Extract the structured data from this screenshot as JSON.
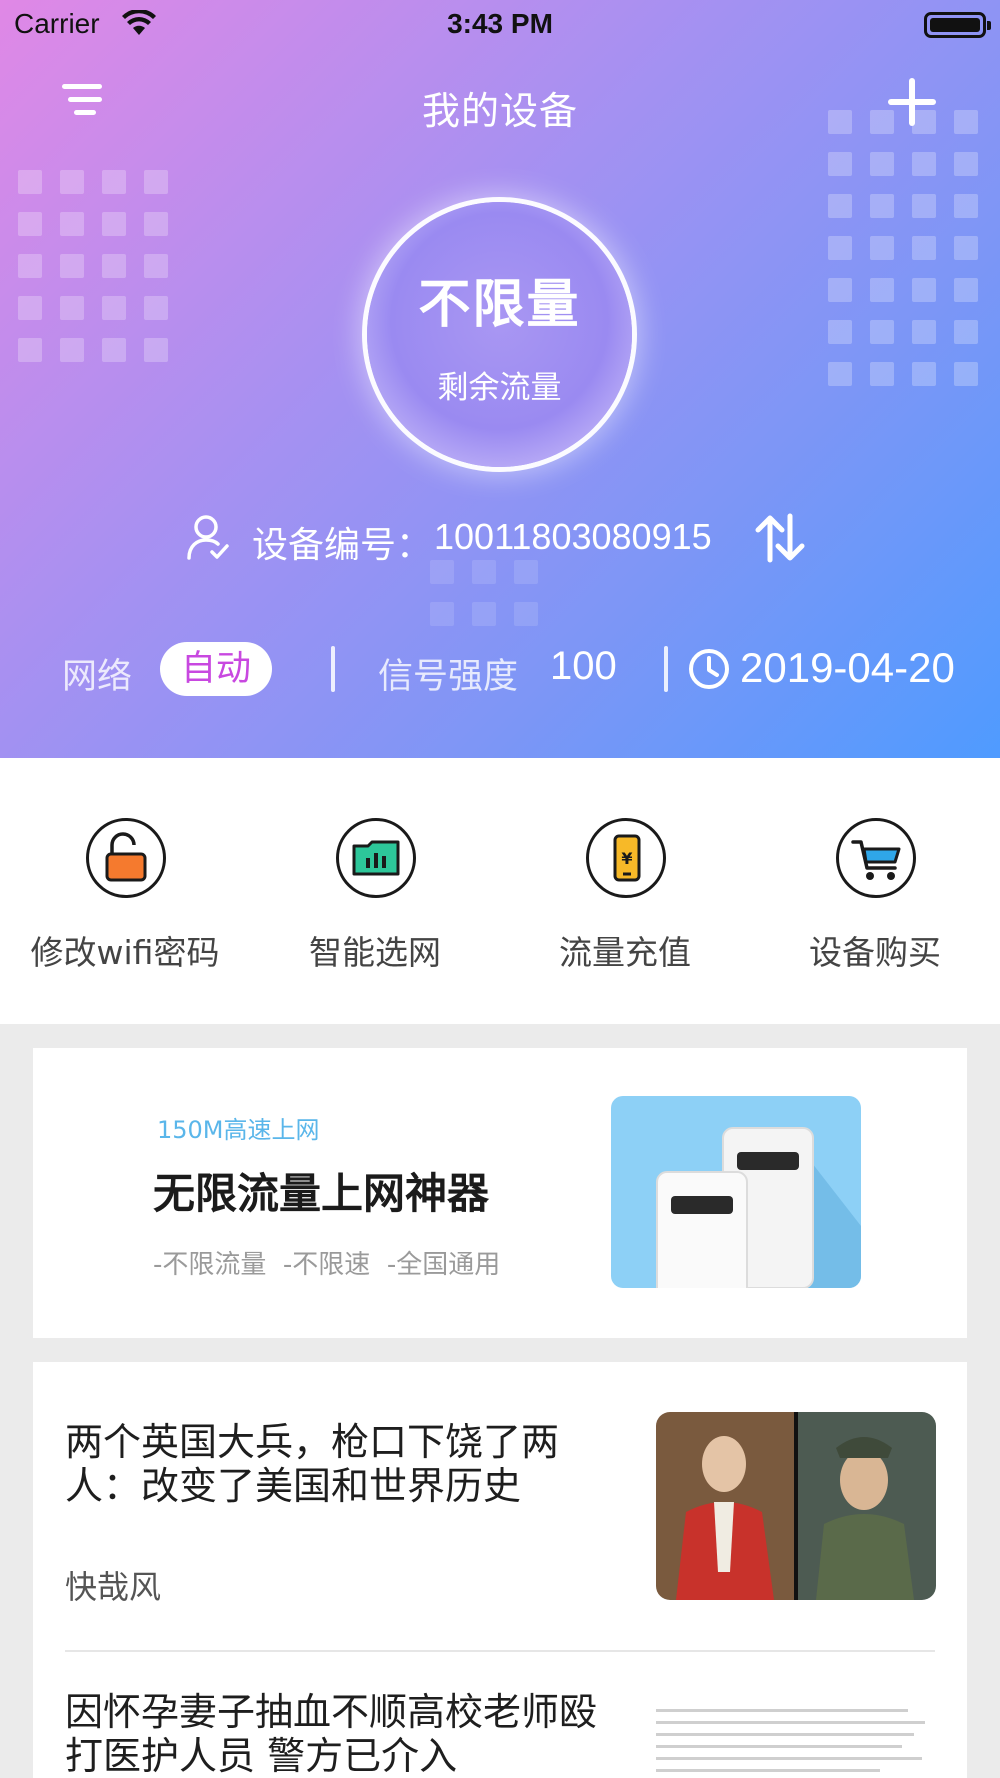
{
  "status_bar": {
    "carrier": "Carrier",
    "time": "3:43 PM",
    "wifi_icon": "wifi-icon",
    "battery_icon": "battery-full-icon"
  },
  "nav": {
    "title": "我的设备",
    "menu_icon": "menu-icon",
    "add_icon": "plus-icon"
  },
  "usage": {
    "main_value": "不限量",
    "label": "剩余流量"
  },
  "device": {
    "label": "设备编号：",
    "number": "10011803080915",
    "user_icon": "user-check-icon",
    "switch_icon": "swap-arrows-icon"
  },
  "info": {
    "network_label": "网络",
    "network_mode": "自动",
    "signal_label": "信号强度",
    "signal_value": "100",
    "clock_icon": "clock-icon",
    "date": "2019-04-20"
  },
  "actions": [
    {
      "label": "修改wifi密码",
      "icon": "unlock-icon"
    },
    {
      "label": "智能选网",
      "icon": "folder-chart-icon"
    },
    {
      "label": "流量充值",
      "icon": "phone-yuan-icon"
    },
    {
      "label": "设备购买",
      "icon": "cart-icon"
    }
  ],
  "banner": {
    "tag": "150M高速上网",
    "title": "无限流量上网神器",
    "subtitle": "-不限流量  -不限速  -全国通用"
  },
  "news": [
    {
      "title": "两个英国大兵，枪口下饶了两人：改变了美国和世界历史",
      "source": "快哉风"
    },
    {
      "title": "因怀孕妻子抽血不顺高校老师殴打医护人员 警方已介入",
      "source": ""
    }
  ],
  "colors": {
    "gradient_start": "#e088e6",
    "gradient_end": "#4f9bff",
    "badge_text": "#c848e0",
    "banner_tag": "#5ab6ea"
  }
}
